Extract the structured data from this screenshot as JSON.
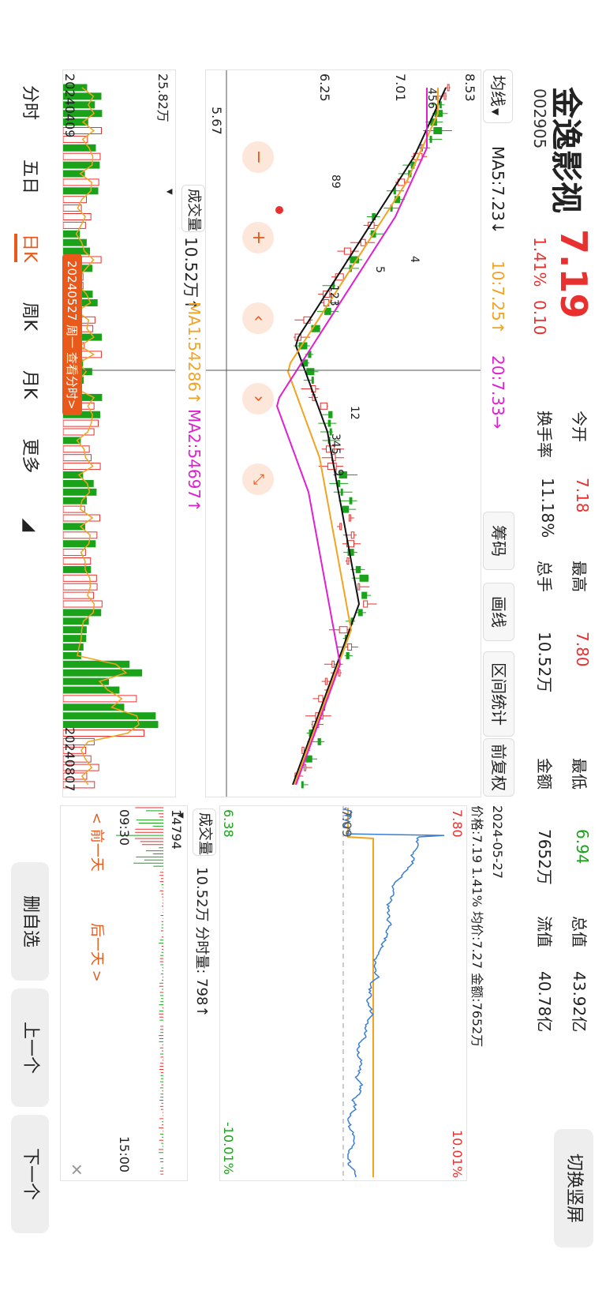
{
  "header": {
    "name": "金逸影视",
    "code": "002905",
    "price": "7.19",
    "change_pct": "1.41%",
    "change_abs": "0.10",
    "switch_label": "切换竖屏"
  },
  "stats": [
    {
      "label": "今开",
      "value": "7.18",
      "color": "red"
    },
    {
      "label": "最高",
      "value": "7.80",
      "color": "red"
    },
    {
      "label": "最低",
      "value": "6.94",
      "color": "green"
    },
    {
      "label": "总值",
      "value": "43.92亿",
      "color": "plain"
    },
    {
      "label": "换手率",
      "value": "11.18%",
      "color": "plain"
    },
    {
      "label": "总手",
      "value": "10.52万",
      "color": "plain"
    },
    {
      "label": "金额",
      "value": "7652万",
      "color": "plain"
    },
    {
      "label": "流值",
      "value": "40.78亿",
      "color": "plain"
    }
  ],
  "toolbar": {
    "ma_select": "均线",
    "ma5": "MA5:7.23↓",
    "ma10": "10:7.25↑",
    "ma20": "20:7.33→",
    "chips": "筹码",
    "draw": "画线",
    "range": "区间统计",
    "adjust": "前复权"
  },
  "kchart": {
    "y_high": "8.53",
    "y_mid1": "7.01",
    "y_mid2": "6.25",
    "y_low": "5.67",
    "labels": [
      "3",
      "456",
      "7",
      "89",
      "123",
      "4",
      "5",
      "6789",
      "12",
      "345",
      "6",
      "7",
      "8",
      "9"
    ]
  },
  "volume": {
    "select": "成交量",
    "value": "10.52万↑",
    "ma1": "MA1:54286↑",
    "ma2": "MA2:54697↑",
    "max": "25.82万",
    "start_date": "20240409",
    "end_date": "20240807",
    "cursor_label": "20240527 周一 查看分时>"
  },
  "tabs": [
    {
      "label": "分时"
    },
    {
      "label": "五日"
    },
    {
      "label": "日K"
    },
    {
      "label": "周K"
    },
    {
      "label": "月K"
    },
    {
      "label": "更多"
    }
  ],
  "intraday": {
    "date": "2024-05-27",
    "price_info": "价格:7.19 1.41% 均价:7.27 金额:7652万",
    "top": "7.80",
    "top_pct": "10.01%",
    "mid": "7.09",
    "bottom": "6.38",
    "bottom_pct": "-10.01%",
    "vol_select": "成交量",
    "vol_info": "10.52万 分时量: 798↑",
    "vol_max": "14794",
    "time_start": "09:30",
    "time_end": "15:00",
    "prev_day": "< 前一天",
    "next_day": "后一天 >"
  },
  "side_buttons": {
    "remove": "删自选",
    "prev": "上一个",
    "next": "下一个"
  },
  "colors": {
    "up": "#e8312f",
    "down": "#1aa31a",
    "accent": "#e8591a",
    "ma5": "#111111",
    "ma10": "#f2a321",
    "ma20": "#e01fd1",
    "intraday_price": "#3a7fd5",
    "intraday_avg": "#f2a321"
  }
}
